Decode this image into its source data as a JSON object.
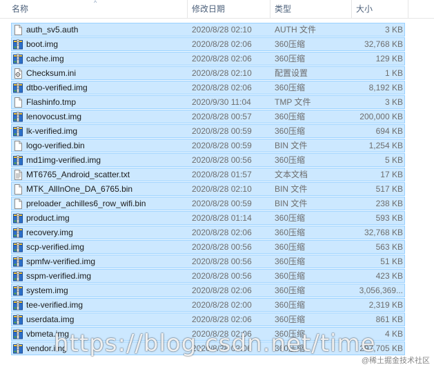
{
  "columns": {
    "name": "名称",
    "date": "修改日期",
    "type": "类型",
    "size": "大小"
  },
  "files": [
    {
      "name": "auth_sv5.auth",
      "date": "2020/8/28 02:10",
      "type": "AUTH 文件",
      "size": "3 KB",
      "icon": "blank-file-icon"
    },
    {
      "name": "boot.img",
      "date": "2020/8/28 02:06",
      "type": "360压缩",
      "size": "32,768 KB",
      "icon": "archive-icon"
    },
    {
      "name": "cache.img",
      "date": "2020/8/28 02:06",
      "type": "360压缩",
      "size": "129 KB",
      "icon": "archive-icon"
    },
    {
      "name": "Checksum.ini",
      "date": "2020/8/28 02:10",
      "type": "配置设置",
      "size": "1 KB",
      "icon": "settings-file-icon"
    },
    {
      "name": "dtbo-verified.img",
      "date": "2020/8/28 02:06",
      "type": "360压缩",
      "size": "8,192 KB",
      "icon": "archive-icon"
    },
    {
      "name": "Flashinfo.tmp",
      "date": "2020/9/30 11:04",
      "type": "TMP 文件",
      "size": "3 KB",
      "icon": "blank-file-icon"
    },
    {
      "name": "lenovocust.img",
      "date": "2020/8/28 00:57",
      "type": "360压缩",
      "size": "200,000 KB",
      "icon": "archive-icon"
    },
    {
      "name": "lk-verified.img",
      "date": "2020/8/28 00:59",
      "type": "360压缩",
      "size": "694 KB",
      "icon": "archive-icon"
    },
    {
      "name": "logo-verified.bin",
      "date": "2020/8/28 00:59",
      "type": "BIN 文件",
      "size": "1,254 KB",
      "icon": "blank-file-icon"
    },
    {
      "name": "md1img-verified.img",
      "date": "2020/8/28 00:56",
      "type": "360压缩",
      "size": "5 KB",
      "icon": "archive-icon"
    },
    {
      "name": "MT6765_Android_scatter.txt",
      "date": "2020/8/28 01:57",
      "type": "文本文档",
      "size": "17 KB",
      "icon": "text-file-icon"
    },
    {
      "name": "MTK_AllInOne_DA_6765.bin",
      "date": "2020/8/28 02:10",
      "type": "BIN 文件",
      "size": "517 KB",
      "icon": "blank-file-icon"
    },
    {
      "name": "preloader_achilles6_row_wifi.bin",
      "date": "2020/8/28 00:59",
      "type": "BIN 文件",
      "size": "238 KB",
      "icon": "blank-file-icon"
    },
    {
      "name": "product.img",
      "date": "2020/8/28 01:14",
      "type": "360压缩",
      "size": "593 KB",
      "icon": "archive-icon"
    },
    {
      "name": "recovery.img",
      "date": "2020/8/28 02:06",
      "type": "360压缩",
      "size": "32,768 KB",
      "icon": "archive-icon"
    },
    {
      "name": "scp-verified.img",
      "date": "2020/8/28 00:56",
      "type": "360压缩",
      "size": "563 KB",
      "icon": "archive-icon"
    },
    {
      "name": "spmfw-verified.img",
      "date": "2020/8/28 00:56",
      "type": "360压缩",
      "size": "51 KB",
      "icon": "archive-icon"
    },
    {
      "name": "sspm-verified.img",
      "date": "2020/8/28 00:56",
      "type": "360压缩",
      "size": "423 KB",
      "icon": "archive-icon"
    },
    {
      "name": "system.img",
      "date": "2020/8/28 02:06",
      "type": "360压缩",
      "size": "3,056,369...",
      "icon": "archive-icon"
    },
    {
      "name": "tee-verified.img",
      "date": "2020/8/28 02:00",
      "type": "360压缩",
      "size": "2,319 KB",
      "icon": "archive-icon"
    },
    {
      "name": "userdata.img",
      "date": "2020/8/28 02:06",
      "type": "360压缩",
      "size": "861 KB",
      "icon": "archive-icon"
    },
    {
      "name": "vbmeta.img",
      "date": "2020/8/28 02:06",
      "type": "360压缩",
      "size": "4 KB",
      "icon": "archive-icon"
    },
    {
      "name": "vendor.img",
      "date": "2020/8/28 02:06",
      "type": "360压缩",
      "size": "297,705 KB",
      "icon": "archive-icon"
    }
  ],
  "watermark": "https://blog.csdn.net/time",
  "watermark_secondary": "@稀土掘金技术社区",
  "colors": {
    "selection_bg": "#cce8ff",
    "selection_border": "#99d1ff",
    "header_text": "#4c607a"
  }
}
